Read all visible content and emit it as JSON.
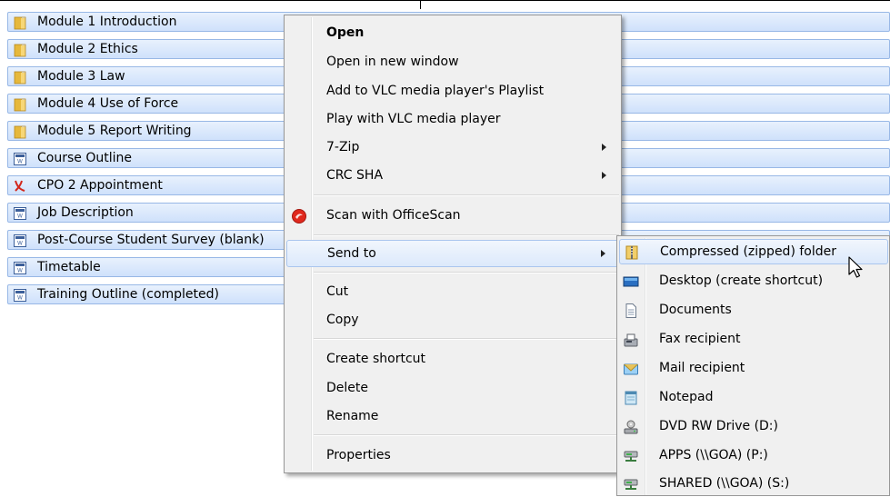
{
  "files": [
    {
      "name": "Module 1 Introduction",
      "icon": "folder-icon"
    },
    {
      "name": "Module 2 Ethics",
      "icon": "folder-icon"
    },
    {
      "name": "Module 3 Law",
      "icon": "folder-icon"
    },
    {
      "name": "Module 4 Use of Force",
      "icon": "folder-icon"
    },
    {
      "name": "Module 5 Report Writing",
      "icon": "folder-icon"
    },
    {
      "name": "Course Outline",
      "icon": "word-document-icon"
    },
    {
      "name": "CPO 2 Appointment",
      "icon": "pdf-document-icon"
    },
    {
      "name": "Job Description",
      "icon": "word-document-icon"
    },
    {
      "name": "Post-Course Student Survey (blank)",
      "icon": "word-document-icon"
    },
    {
      "name": "Timetable",
      "icon": "word-document-icon"
    },
    {
      "name": "Training Outline (completed)",
      "icon": "word-document-icon"
    }
  ],
  "context_menu": {
    "open": "Open",
    "open_new_window": "Open in new window",
    "add_vlc_playlist": "Add to VLC media player's Playlist",
    "play_vlc": "Play with VLC media player",
    "seven_zip": "7-Zip",
    "crc_sha": "CRC SHA",
    "scan_officescan": "Scan with OfficeScan",
    "send_to": "Send to",
    "cut": "Cut",
    "copy": "Copy",
    "create_shortcut": "Create shortcut",
    "delete": "Delete",
    "rename": "Rename",
    "properties": "Properties"
  },
  "send_to_menu": [
    {
      "label": "Compressed (zipped) folder",
      "icon": "zip-folder-icon"
    },
    {
      "label": "Desktop (create shortcut)",
      "icon": "desktop-icon"
    },
    {
      "label": "Documents",
      "icon": "documents-icon"
    },
    {
      "label": "Fax recipient",
      "icon": "fax-icon"
    },
    {
      "label": "Mail recipient",
      "icon": "mail-icon"
    },
    {
      "label": "Notepad",
      "icon": "notepad-icon"
    },
    {
      "label": "DVD RW Drive (D:)",
      "icon": "dvd-drive-icon"
    },
    {
      "label": "APPS (\\\\GOA) (P:)",
      "icon": "network-drive-icon"
    },
    {
      "label": "SHARED (\\\\GOA) (S:)",
      "icon": "network-drive-icon"
    }
  ],
  "colors": {
    "selection": "#cfe1fb",
    "menu_bg": "#f0f0f0",
    "highlight_border": "#aac6ee"
  }
}
